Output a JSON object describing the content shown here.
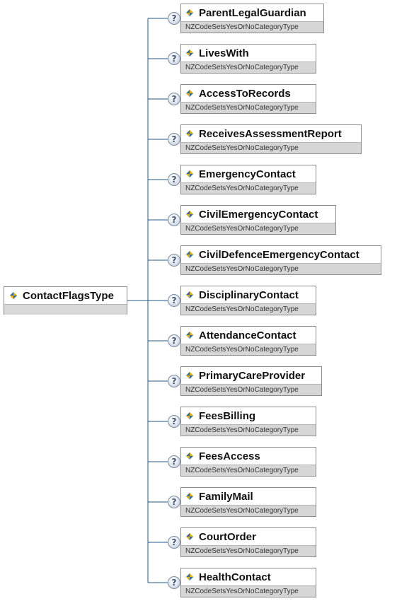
{
  "root": {
    "name": "ContactFlagsType",
    "icon": "complex-type-icon"
  },
  "colors": {
    "connector": "#1f5a86",
    "icon_yellow": "#f0b400",
    "icon_blue": "#2e6da4",
    "type_strip": "#d6d6d6"
  },
  "optional_marker": "?",
  "elements": [
    {
      "name": "ParentLegalGuardian",
      "type": "NZCodeSetsYesOrNoCategoryType"
    },
    {
      "name": "LivesWith",
      "type": "NZCodeSetsYesOrNoCategoryType"
    },
    {
      "name": "AccessToRecords",
      "type": "NZCodeSetsYesOrNoCategoryType"
    },
    {
      "name": "ReceivesAssessmentReport",
      "type": "NZCodeSetsYesOrNoCategoryType"
    },
    {
      "name": "EmergencyContact",
      "type": "NZCodeSetsYesOrNoCategoryType"
    },
    {
      "name": "CivilEmergencyContact",
      "type": "NZCodeSetsYesOrNoCategoryType"
    },
    {
      "name": "CivilDefenceEmergencyContact",
      "type": "NZCodeSetsYesOrNoCategoryType"
    },
    {
      "name": "DisciplinaryContact",
      "type": "NZCodeSetsYesOrNoCategoryType"
    },
    {
      "name": "AttendanceContact",
      "type": "NZCodeSetsYesOrNoCategoryType"
    },
    {
      "name": "PrimaryCareProvider",
      "type": "NZCodeSetsYesOrNoCategoryType"
    },
    {
      "name": "FeesBilling",
      "type": "NZCodeSetsYesOrNoCategoryType"
    },
    {
      "name": "FeesAccess",
      "type": "NZCodeSetsYesOrNoCategoryType"
    },
    {
      "name": "FamilyMail",
      "type": "NZCodeSetsYesOrNoCategoryType"
    },
    {
      "name": "CourtOrder",
      "type": "NZCodeSetsYesOrNoCategoryType"
    },
    {
      "name": "HealthContact",
      "type": "NZCodeSetsYesOrNoCategoryType"
    }
  ]
}
